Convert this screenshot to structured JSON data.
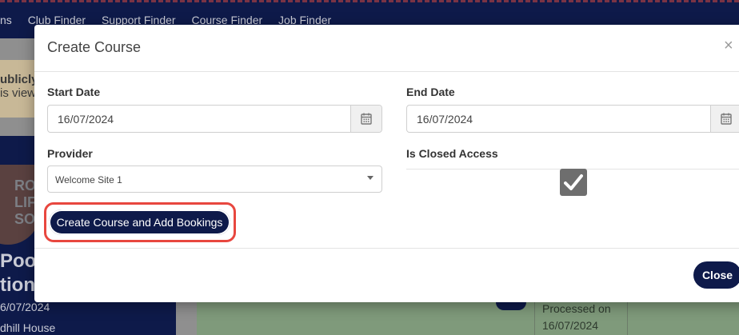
{
  "background": {
    "nav_links": [
      "ns",
      "Club Finder",
      "Support Finder",
      "Course Finder",
      "Job Finder"
    ],
    "notice_line1": "ublicly",
    "notice_line2": "is view",
    "logo_text": [
      "RO",
      "LIF",
      "SO"
    ],
    "pool_line1": "Pool",
    "pool_line2": "tion",
    "date": "6/07/2024",
    "house": "dhill House",
    "processed_line1": "Processed on",
    "processed_line2": "16/07/2024"
  },
  "modal": {
    "title": "Create Course",
    "close_x": "×",
    "start_date": {
      "label": "Start Date",
      "value": "16/07/2024"
    },
    "end_date": {
      "label": "End Date",
      "value": "16/07/2024"
    },
    "provider": {
      "label": "Provider",
      "value": "Welcome Site 1"
    },
    "closed_access": {
      "label": "Is Closed Access",
      "checked": true
    },
    "create_button": "Create Course and Add Bookings",
    "close_button": "Close"
  },
  "colors": {
    "brand_navy": "#0e1a4a",
    "highlight": "#e8473f",
    "checkbox": "#6e6e6e"
  }
}
